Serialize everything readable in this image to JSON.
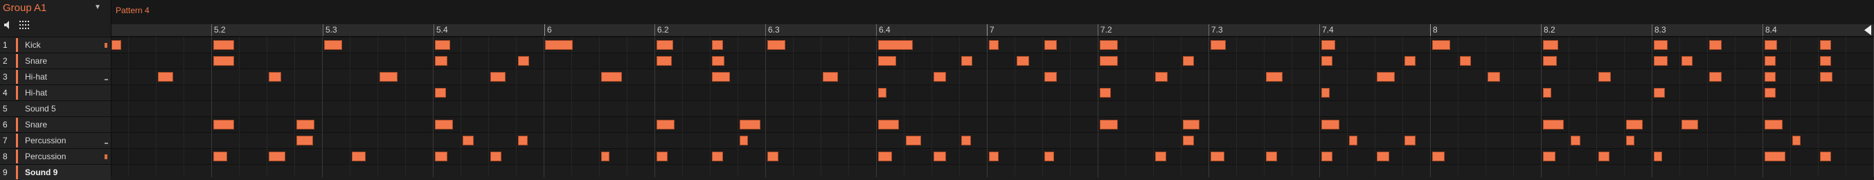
{
  "group": {
    "name": "Group A1"
  },
  "pattern": {
    "name": "Pattern 4"
  },
  "ruler": {
    "labels": [
      "5.2",
      "5.3",
      "5.4",
      "6",
      "6.2",
      "6.3",
      "6.4",
      "7",
      "7.2",
      "7.3",
      "7.4",
      "8",
      "8.2",
      "8.3",
      "8.4"
    ]
  },
  "sounds": [
    {
      "number": "1",
      "name": "Kick"
    },
    {
      "number": "2",
      "name": "Snare"
    },
    {
      "number": "3",
      "name": "Hi-hat"
    },
    {
      "number": "4",
      "name": "Hi-hat"
    },
    {
      "number": "5",
      "name": "Sound 5"
    },
    {
      "number": "6",
      "name": "Snare"
    },
    {
      "number": "7",
      "name": "Percussion"
    },
    {
      "number": "8",
      "name": "Percussion"
    },
    {
      "number": "9",
      "name": "Sound 9"
    }
  ],
  "colors": {
    "accent": "#f2784b",
    "note": "#f2784b"
  },
  "icons": [
    "speaker-icon",
    "grid-icon",
    "chevron-down-icon",
    "playhead-icon"
  ]
}
